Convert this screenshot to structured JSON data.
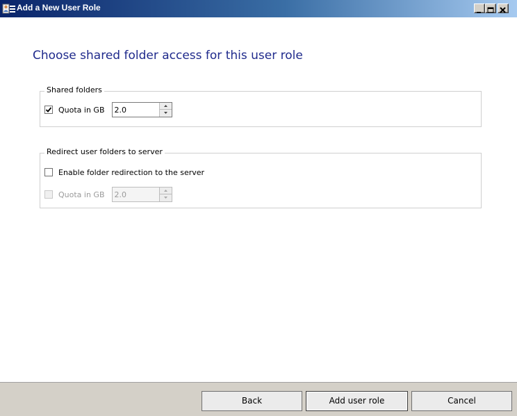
{
  "window": {
    "title": "Add a New User Role",
    "icon": "user-role-icon",
    "controls": [
      "minimize-icon",
      "maximize-icon",
      "close-icon"
    ]
  },
  "page": {
    "heading": "Choose shared folder access for this user role"
  },
  "shared_folders": {
    "legend": "Shared folders",
    "quota_checkbox": {
      "label": "Quota in GB",
      "checked": true,
      "enabled": true
    },
    "quota_value": "2.0"
  },
  "redirect": {
    "legend": "Redirect user folders to server",
    "enable_checkbox": {
      "label": "Enable folder redirection to the server",
      "checked": false,
      "enabled": true
    },
    "quota_checkbox": {
      "label": "Quota in GB",
      "checked": false,
      "enabled": false
    },
    "quota_value": "2.0"
  },
  "footer": {
    "back_label": "Back",
    "add_label": "Add user role",
    "cancel_label": "Cancel"
  },
  "colors": {
    "heading": "#1f2a8c",
    "titlebar_start": "#0a246a",
    "titlebar_end": "#a6caf0",
    "footer_bg": "#d4d0c8"
  }
}
